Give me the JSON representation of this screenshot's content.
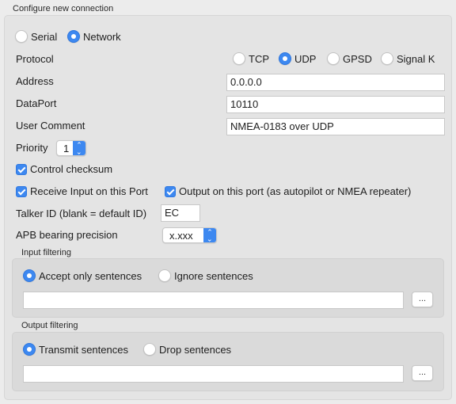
{
  "title": "Configure new connection",
  "connection_type": {
    "options": [
      "Serial",
      "Network"
    ],
    "selected": "Network"
  },
  "protocol": {
    "label": "Protocol",
    "options": [
      "TCP",
      "UDP",
      "GPSD",
      "Signal K"
    ],
    "selected": "UDP"
  },
  "address": {
    "label": "Address",
    "value": "0.0.0.0"
  },
  "dataport": {
    "label": "DataPort",
    "value": "10110"
  },
  "user_comment": {
    "label": "User Comment",
    "value": "NMEA-0183 over UDP"
  },
  "priority": {
    "label": "Priority",
    "value": "1"
  },
  "control_checksum": {
    "label": "Control checksum",
    "checked": true
  },
  "receive_input": {
    "label": "Receive Input on this Port",
    "checked": true
  },
  "output_port": {
    "label": "Output on this port (as autopilot or NMEA repeater)",
    "checked": true
  },
  "talker_id": {
    "label": "Talker ID (blank = default ID)",
    "value": "EC"
  },
  "apb_precision": {
    "label": "APB bearing precision",
    "value": "x.xxx"
  },
  "input_filtering": {
    "title": "Input filtering",
    "options": [
      "Accept only sentences",
      "Ignore sentences"
    ],
    "selected": "Accept only sentences",
    "value": "",
    "button_label": "..."
  },
  "output_filtering": {
    "title": "Output filtering",
    "options": [
      "Transmit sentences",
      "Drop sentences"
    ],
    "selected": "Transmit sentences",
    "value": "",
    "button_label": "..."
  },
  "colors": {
    "accent": "#3d88f0",
    "panel": "#e4e4e4",
    "window": "#ececec"
  }
}
